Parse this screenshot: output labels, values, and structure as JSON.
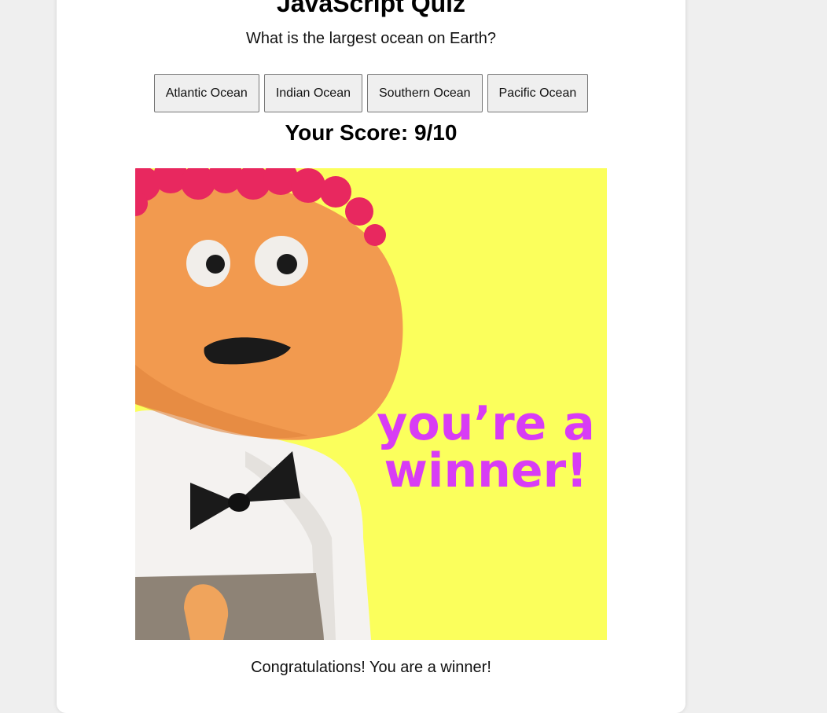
{
  "quiz": {
    "title": "JavaScript Quiz",
    "question": "What is the largest ocean on Earth?",
    "options": [
      "Atlantic Ocean",
      "Indian Ocean",
      "Southern Ocean",
      "Pacific Ocean"
    ],
    "score_text": "Your Score: 9/10",
    "image": {
      "caption": "you’re a winner!",
      "caption_line1": "you’re a",
      "caption_line2": "winner!",
      "background_color": "#fbff5c",
      "caption_color": "#d83cf5"
    },
    "congrats_message": "Congratulations! You are a winner!"
  },
  "colors": {
    "page_background": "#efefef",
    "card_background": "#ffffff",
    "button_background": "#efefef"
  }
}
